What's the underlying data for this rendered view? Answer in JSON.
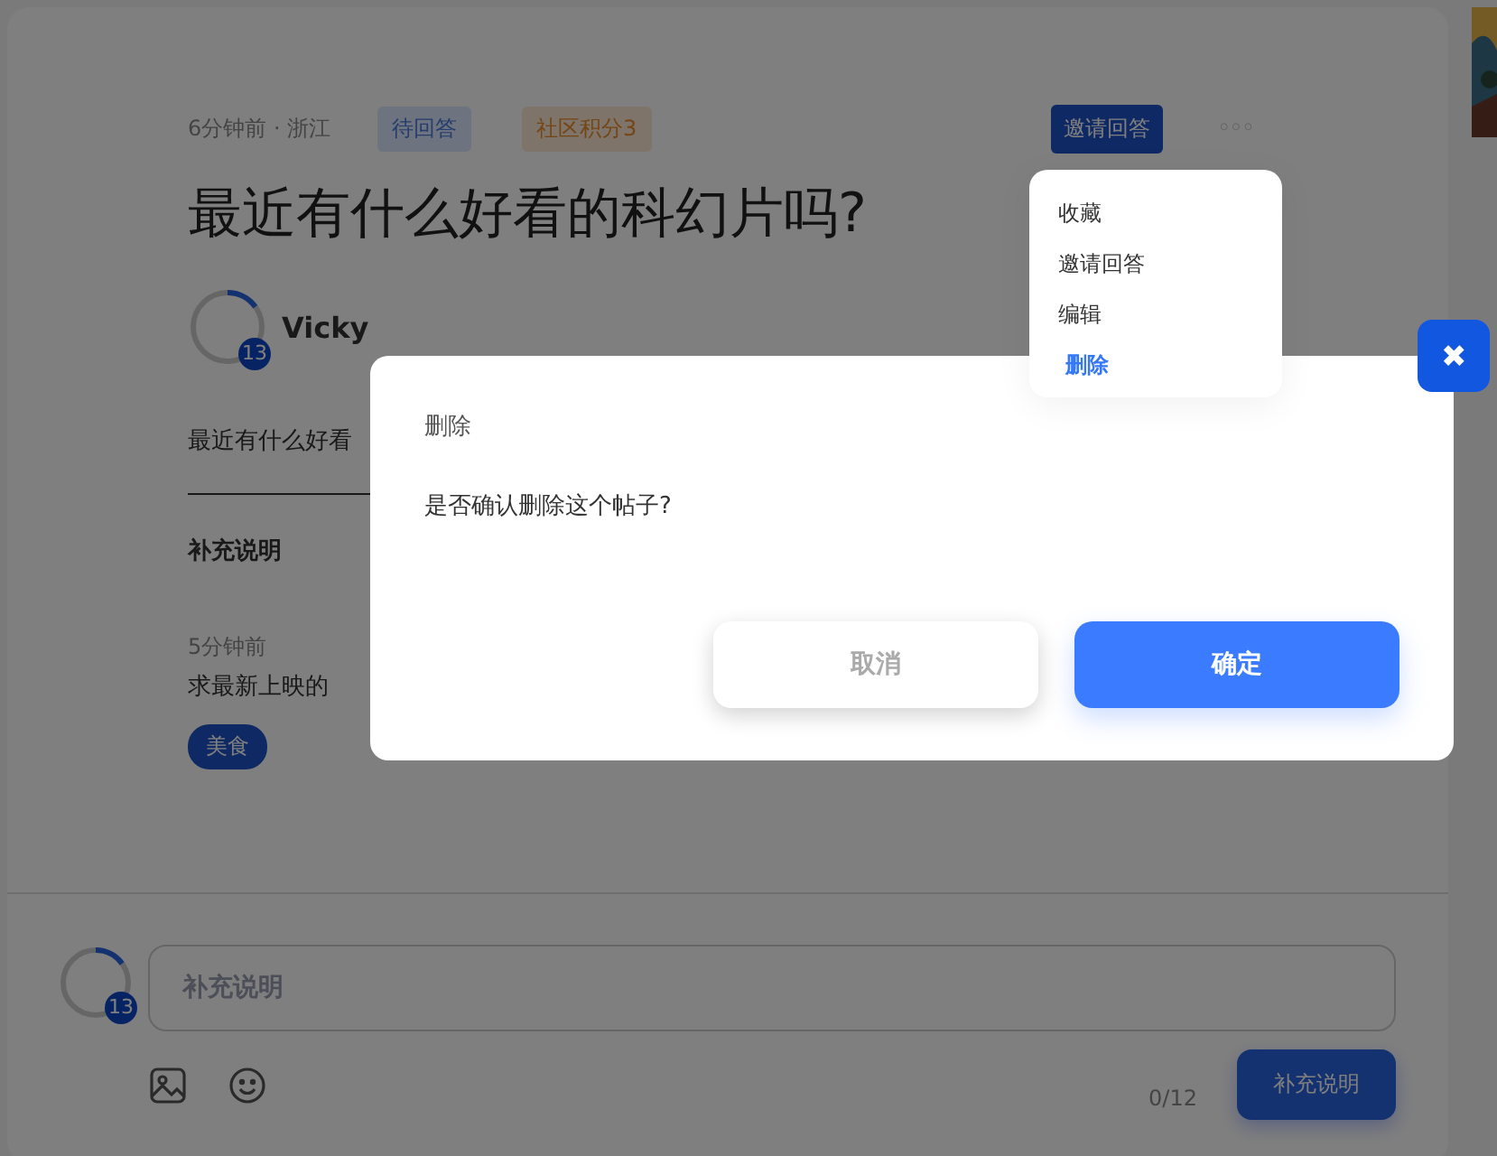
{
  "post": {
    "meta": "6分钟前 · 浙江",
    "tags": [
      {
        "label": "待回答",
        "kind": "status"
      },
      {
        "label": "社区积分3",
        "kind": "points"
      }
    ],
    "invite_button": "邀请回答",
    "more_button": "◦◦◦",
    "title": "最近有什么好看的科幻片吗?",
    "author": {
      "name": "Vicky",
      "badge": "13"
    },
    "body": "最近有什么好看",
    "supplement": {
      "heading": "补充说明",
      "time": "5分钟前",
      "text": "求最新上映的",
      "tag": "美食"
    }
  },
  "composer": {
    "badge": "13",
    "placeholder": "补充说明",
    "count": "0/12",
    "submit": "补充说明"
  },
  "menu": {
    "items": [
      {
        "label": "收藏",
        "selected": false
      },
      {
        "label": "邀请回答",
        "selected": false
      },
      {
        "label": "编辑",
        "selected": false
      },
      {
        "label": "删除",
        "selected": true
      }
    ]
  },
  "dialog": {
    "title": "删除",
    "message": "是否确认删除这个帖子?",
    "buttons": [
      {
        "label": "取消",
        "kind": "secondary"
      },
      {
        "label": "确定",
        "kind": "primary"
      }
    ]
  },
  "close_button": "✖"
}
